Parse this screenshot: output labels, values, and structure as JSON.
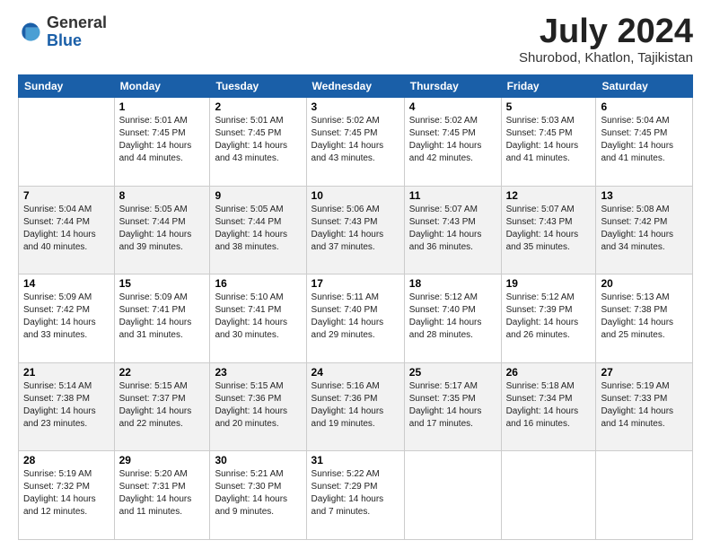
{
  "header": {
    "logo": {
      "general": "General",
      "blue": "Blue"
    },
    "title": "July 2024",
    "location": "Shurobod, Khatlon, Tajikistan"
  },
  "calendar": {
    "weekdays": [
      "Sunday",
      "Monday",
      "Tuesday",
      "Wednesday",
      "Thursday",
      "Friday",
      "Saturday"
    ],
    "weeks": [
      [
        {
          "day": "",
          "info": ""
        },
        {
          "day": "1",
          "info": "Sunrise: 5:01 AM\nSunset: 7:45 PM\nDaylight: 14 hours\nand 44 minutes."
        },
        {
          "day": "2",
          "info": "Sunrise: 5:01 AM\nSunset: 7:45 PM\nDaylight: 14 hours\nand 43 minutes."
        },
        {
          "day": "3",
          "info": "Sunrise: 5:02 AM\nSunset: 7:45 PM\nDaylight: 14 hours\nand 43 minutes."
        },
        {
          "day": "4",
          "info": "Sunrise: 5:02 AM\nSunset: 7:45 PM\nDaylight: 14 hours\nand 42 minutes."
        },
        {
          "day": "5",
          "info": "Sunrise: 5:03 AM\nSunset: 7:45 PM\nDaylight: 14 hours\nand 41 minutes."
        },
        {
          "day": "6",
          "info": "Sunrise: 5:04 AM\nSunset: 7:45 PM\nDaylight: 14 hours\nand 41 minutes."
        }
      ],
      [
        {
          "day": "7",
          "info": "Sunrise: 5:04 AM\nSunset: 7:44 PM\nDaylight: 14 hours\nand 40 minutes."
        },
        {
          "day": "8",
          "info": "Sunrise: 5:05 AM\nSunset: 7:44 PM\nDaylight: 14 hours\nand 39 minutes."
        },
        {
          "day": "9",
          "info": "Sunrise: 5:05 AM\nSunset: 7:44 PM\nDaylight: 14 hours\nand 38 minutes."
        },
        {
          "day": "10",
          "info": "Sunrise: 5:06 AM\nSunset: 7:43 PM\nDaylight: 14 hours\nand 37 minutes."
        },
        {
          "day": "11",
          "info": "Sunrise: 5:07 AM\nSunset: 7:43 PM\nDaylight: 14 hours\nand 36 minutes."
        },
        {
          "day": "12",
          "info": "Sunrise: 5:07 AM\nSunset: 7:43 PM\nDaylight: 14 hours\nand 35 minutes."
        },
        {
          "day": "13",
          "info": "Sunrise: 5:08 AM\nSunset: 7:42 PM\nDaylight: 14 hours\nand 34 minutes."
        }
      ],
      [
        {
          "day": "14",
          "info": "Sunrise: 5:09 AM\nSunset: 7:42 PM\nDaylight: 14 hours\nand 33 minutes."
        },
        {
          "day": "15",
          "info": "Sunrise: 5:09 AM\nSunset: 7:41 PM\nDaylight: 14 hours\nand 31 minutes."
        },
        {
          "day": "16",
          "info": "Sunrise: 5:10 AM\nSunset: 7:41 PM\nDaylight: 14 hours\nand 30 minutes."
        },
        {
          "day": "17",
          "info": "Sunrise: 5:11 AM\nSunset: 7:40 PM\nDaylight: 14 hours\nand 29 minutes."
        },
        {
          "day": "18",
          "info": "Sunrise: 5:12 AM\nSunset: 7:40 PM\nDaylight: 14 hours\nand 28 minutes."
        },
        {
          "day": "19",
          "info": "Sunrise: 5:12 AM\nSunset: 7:39 PM\nDaylight: 14 hours\nand 26 minutes."
        },
        {
          "day": "20",
          "info": "Sunrise: 5:13 AM\nSunset: 7:38 PM\nDaylight: 14 hours\nand 25 minutes."
        }
      ],
      [
        {
          "day": "21",
          "info": "Sunrise: 5:14 AM\nSunset: 7:38 PM\nDaylight: 14 hours\nand 23 minutes."
        },
        {
          "day": "22",
          "info": "Sunrise: 5:15 AM\nSunset: 7:37 PM\nDaylight: 14 hours\nand 22 minutes."
        },
        {
          "day": "23",
          "info": "Sunrise: 5:15 AM\nSunset: 7:36 PM\nDaylight: 14 hours\nand 20 minutes."
        },
        {
          "day": "24",
          "info": "Sunrise: 5:16 AM\nSunset: 7:36 PM\nDaylight: 14 hours\nand 19 minutes."
        },
        {
          "day": "25",
          "info": "Sunrise: 5:17 AM\nSunset: 7:35 PM\nDaylight: 14 hours\nand 17 minutes."
        },
        {
          "day": "26",
          "info": "Sunrise: 5:18 AM\nSunset: 7:34 PM\nDaylight: 14 hours\nand 16 minutes."
        },
        {
          "day": "27",
          "info": "Sunrise: 5:19 AM\nSunset: 7:33 PM\nDaylight: 14 hours\nand 14 minutes."
        }
      ],
      [
        {
          "day": "28",
          "info": "Sunrise: 5:19 AM\nSunset: 7:32 PM\nDaylight: 14 hours\nand 12 minutes."
        },
        {
          "day": "29",
          "info": "Sunrise: 5:20 AM\nSunset: 7:31 PM\nDaylight: 14 hours\nand 11 minutes."
        },
        {
          "day": "30",
          "info": "Sunrise: 5:21 AM\nSunset: 7:30 PM\nDaylight: 14 hours\nand 9 minutes."
        },
        {
          "day": "31",
          "info": "Sunrise: 5:22 AM\nSunset: 7:29 PM\nDaylight: 14 hours\nand 7 minutes."
        },
        {
          "day": "",
          "info": ""
        },
        {
          "day": "",
          "info": ""
        },
        {
          "day": "",
          "info": ""
        }
      ]
    ]
  }
}
